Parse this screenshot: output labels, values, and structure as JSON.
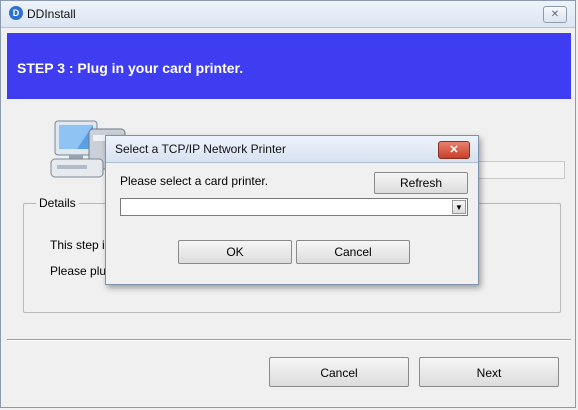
{
  "window": {
    "title": "DDInstall",
    "close_glyph": "✕",
    "app_icon": "D"
  },
  "header": {
    "step_text": "STEP 3 :  Plug in your card printer."
  },
  "details": {
    "legend": "Details",
    "line1": "This step ins",
    "line2": "Please plug"
  },
  "footer": {
    "cancel_label": "Cancel",
    "next_label": "Next"
  },
  "dialog": {
    "title": "Select a TCP/IP Network Printer",
    "close_glyph": "✕",
    "prompt": "Please select a card printer.",
    "refresh_label": "Refresh",
    "selected_value": "",
    "ok_label": "OK",
    "cancel_label": "Cancel"
  },
  "colors": {
    "header_blue": "#3f3df2",
    "dialog_close_red": "#c6402a"
  }
}
